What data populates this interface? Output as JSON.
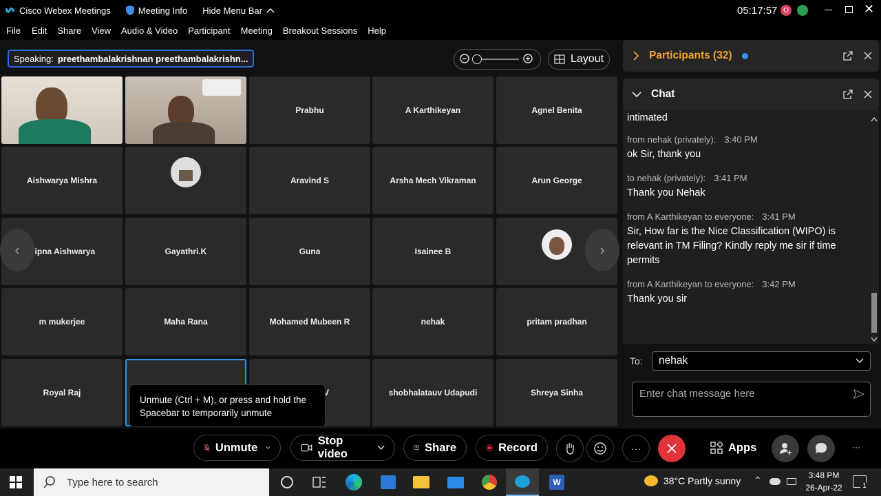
{
  "titlebar": {
    "app": "Cisco Webex Meetings",
    "meeting_info": "Meeting Info",
    "hide_menu": "Hide Menu Bar",
    "clock": "05:17:57",
    "badge_letter": "O"
  },
  "menu": [
    "File",
    "Edit",
    "Share",
    "View",
    "Audio & Video",
    "Participant",
    "Meeting",
    "Breakout Sessions",
    "Help"
  ],
  "speaking": {
    "label": "Speaking:",
    "names": "preethambalakrishnan preethambalakrishn..."
  },
  "layout_label": "Layout",
  "tiles": {
    "t0": "",
    "t1": "",
    "t2": "Prabhu",
    "t3": "A Karthikeyan",
    "t4": "Agnel Benita",
    "t5": "Aishwarya Mishra",
    "t6": "",
    "t7": "Aravind S",
    "t8": "Arsha Mech Vikraman",
    "t9": "Arun George",
    "t10": "Dipna Aishwarya",
    "t11": "Gayathri.K",
    "t12": "Guna",
    "t13": "Isainee B",
    "t14": "",
    "t15": "m mukerjee",
    "t16": "Maha Rana",
    "t17": "Mohamed Mubeen R",
    "t18": "nehak",
    "t19": "pritam pradhan",
    "t20": "Royal Raj",
    "t21": "",
    "t22": "V",
    "t23": "shobhalatauv Udapudi",
    "t24": "Shreya Sinha"
  },
  "tooltip": "Unmute (Ctrl + M), or press and hold the Spacebar to temporarily unmute",
  "panel": {
    "participants": "Participants (32)",
    "chat": "Chat",
    "messages": [
      {
        "meta": "",
        "time": "",
        "text": "intimated"
      },
      {
        "meta": "from nehak (privately):",
        "time": "3:40 PM",
        "text": "ok Sir, thank you"
      },
      {
        "meta": "to nehak (privately):",
        "time": "3:41 PM",
        "text": "Thank you Nehak"
      },
      {
        "meta": "from A Karthikeyan to everyone:",
        "time": "3:41 PM",
        "text": "Sir, How far is the Nice Classification (WIPO)  is relevant in TM Filing? Kindly reply me sir if time permits"
      },
      {
        "meta": "from A Karthikeyan to everyone:",
        "time": "3:42 PM",
        "text": "Thank you sir"
      }
    ],
    "to_label": "To:",
    "to_value": "nehak",
    "placeholder": "Enter chat message here"
  },
  "controls": {
    "unmute": "Unmute",
    "stop_video": "Stop video",
    "share": "Share",
    "record": "Record",
    "apps": "Apps",
    "more": "···"
  },
  "taskbar": {
    "search": "Type here to search",
    "weather": "38°C  Partly sunny",
    "time": "3:48 PM",
    "date": "26-Apr-22",
    "notif": "1"
  },
  "colors": {
    "accent": "#3b8fe8",
    "participants_header": "#f0a030",
    "end_button": "#e0333a",
    "record_dot": "#e0333a"
  }
}
